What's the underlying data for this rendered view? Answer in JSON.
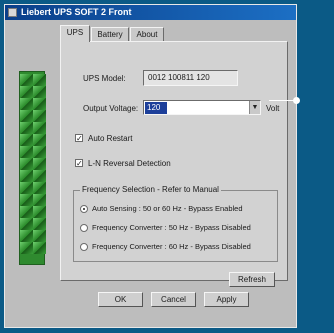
{
  "window": {
    "title": "Liebert UPS SOFT 2 Front"
  },
  "tabs": [
    {
      "label": "UPS",
      "active": true
    },
    {
      "label": "Battery",
      "active": false
    },
    {
      "label": "About",
      "active": false
    }
  ],
  "ups": {
    "model_label": "UPS Model:",
    "model_value": "0012 100811 120",
    "output_voltage_label": "Output Voltage:",
    "output_voltage_value": "120",
    "units": "Volt"
  },
  "options": {
    "auto_restart_label": "Auto Restart",
    "auto_restart_checked": true,
    "line_reversal_label": "L-N Reversal Detection",
    "line_reversal_checked": true
  },
  "frequency": {
    "group_label": "Frequency Selection - Refer to Manual",
    "options": [
      {
        "label": "Auto Sensing : 50 or 60 Hz - Bypass Enabled",
        "selected": true
      },
      {
        "label": "Frequency Converter : 50 Hz - Bypass Disabled",
        "selected": false
      },
      {
        "label": "Frequency Converter : 60 Hz - Bypass Disabled",
        "selected": false
      }
    ]
  },
  "buttons": {
    "refresh": "Refresh",
    "ok": "OK",
    "cancel": "Cancel",
    "apply": "Apply"
  },
  "colors": {
    "desktop": "#0b5a86",
    "titlebar": "#0a3f8a",
    "panel_green": "#2f8a2f"
  }
}
